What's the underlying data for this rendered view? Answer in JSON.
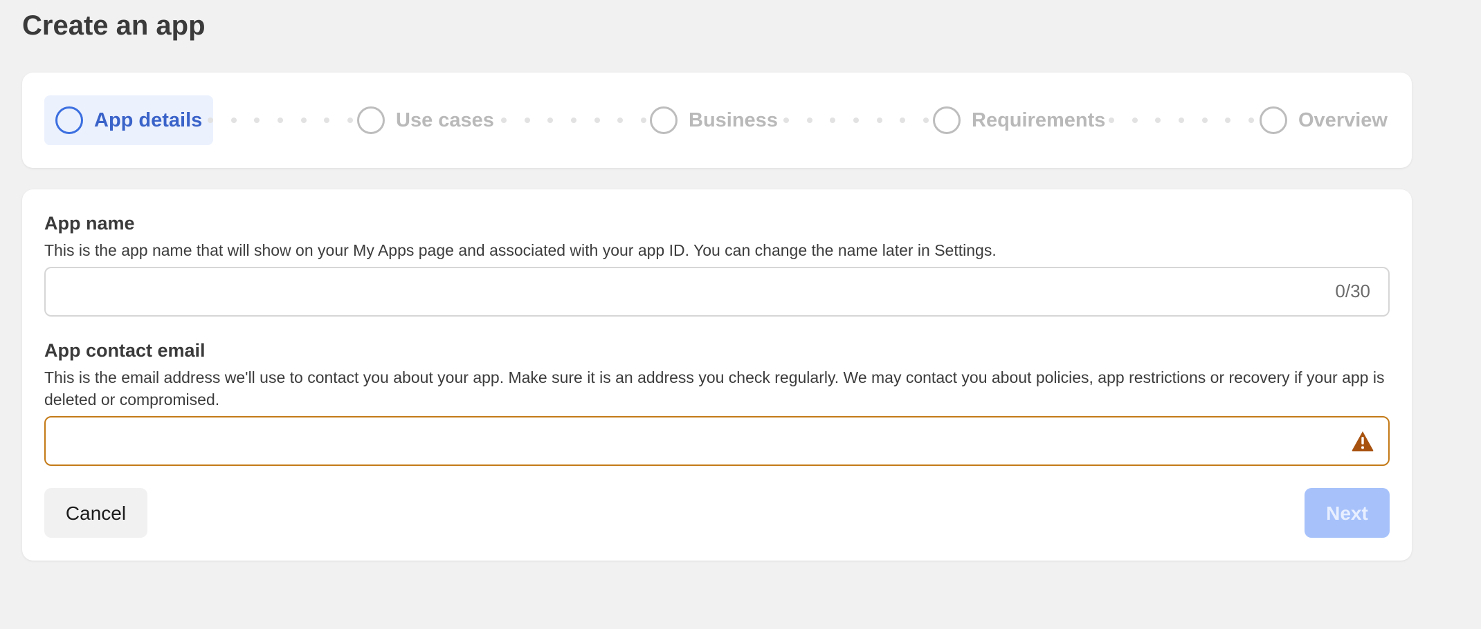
{
  "page": {
    "title": "Create an app"
  },
  "stepper": {
    "steps": [
      {
        "label": "App details",
        "state": "active"
      },
      {
        "label": "Use cases",
        "state": "inactive"
      },
      {
        "label": "Business",
        "state": "inactive"
      },
      {
        "label": "Requirements",
        "state": "inactive"
      },
      {
        "label": "Overview",
        "state": "inactive"
      }
    ]
  },
  "form": {
    "app_name": {
      "label": "App name",
      "description": "This is the app name that will show on your My Apps page and associated with your app ID. You can change the name later in Settings.",
      "value": "",
      "char_count": "0/30"
    },
    "contact_email": {
      "label": "App contact email",
      "description": "This is the email address we'll use to contact you about your app. Make sure it is an address you check regularly. We may contact you about policies, app restrictions or recovery if your app is deleted or compromised.",
      "value": "",
      "status_icon": "warning-icon"
    },
    "cancel_label": "Cancel",
    "next_label": "Next"
  },
  "colors": {
    "accent": "#3b6fe0",
    "active_step_bg": "#ebf1fd",
    "warning": "#a8520f",
    "next_disabled": "#a7c2fb"
  }
}
